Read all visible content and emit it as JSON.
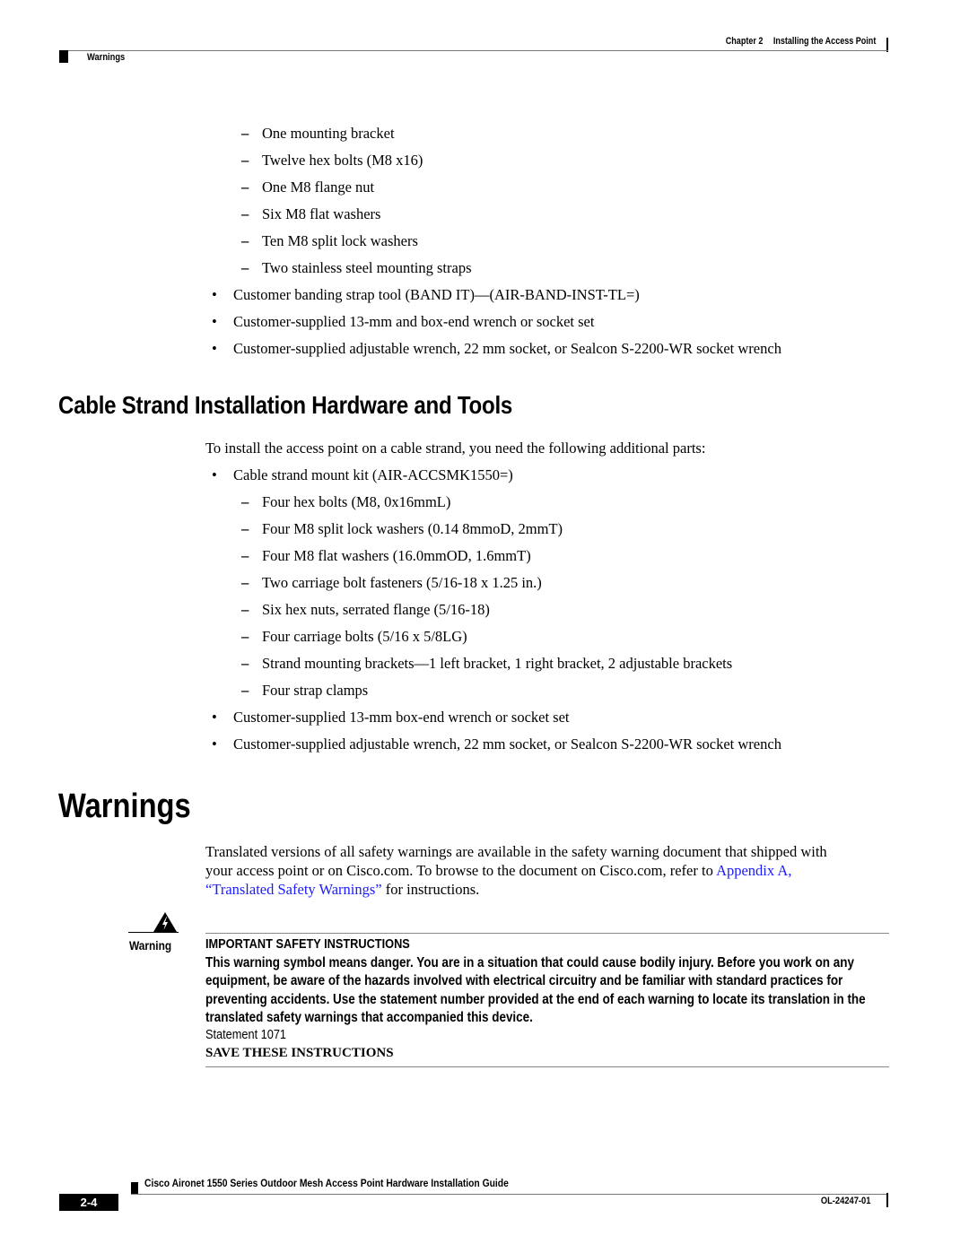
{
  "header": {
    "chapter_label": "Chapter 2",
    "chapter_title": "Installing the Access Point",
    "section": "Warnings"
  },
  "intro_list": {
    "dash_items": [
      "One mounting bracket",
      "Twelve hex bolts (M8 x16)",
      "One M8 flange nut",
      "Six M8 flat washers",
      "Ten M8 split lock washers",
      "Two stainless steel mounting straps"
    ],
    "bullet_items": [
      "Customer banding strap tool (BAND IT)—(AIR-BAND-INST-TL=)",
      "Customer-supplied 13-mm and box-end wrench or socket set",
      "Customer-supplied adjustable wrench, 22 mm socket, or Sealcon S-2200-WR socket wrench"
    ]
  },
  "cable_strand": {
    "heading": "Cable Strand Installation Hardware and Tools",
    "intro": "To install the access point on a cable strand, you need the following additional parts:",
    "kit_bullet": "Cable strand mount kit (AIR-ACCSMK1550=)",
    "dash_items": [
      "Four hex bolts (M8, 0x16mmL)",
      "Four M8 split lock washers (0.14 8mmoD, 2mmT)",
      "Four M8 flat washers (16.0mmOD, 1.6mmT)",
      "Two carriage bolt fasteners (5/16-18 x 1.25 in.)",
      "Six hex nuts, serrated flange (5/16-18)",
      "Four carriage bolts (5/16 x 5/8LG)",
      "Strand mounting brackets—1 left bracket, 1 right bracket, 2 adjustable brackets",
      "Four strap clamps"
    ],
    "bullet_items": [
      "Customer-supplied 13-mm box-end wrench or socket set",
      "Customer-supplied adjustable wrench, 22 mm socket, or Sealcon S-2200-WR socket wrench"
    ]
  },
  "warnings": {
    "heading": "Warnings",
    "para_line1": "Translated versions of all safety warnings are available in the safety warning document that shipped with",
    "para_line2_pre": "your access point or on Cisco.com. To browse to the document on Cisco.com, refer to ",
    "link_part1": "Appendix A,",
    "link_part2": "“Translated Safety Warnings”",
    "para_line3_post": " for instructions.",
    "warning_box": {
      "icon": "warning-triangle-lightning-icon",
      "label": "Warning",
      "title": "IMPORTANT SAFETY INSTRUCTIONS",
      "body": "This warning symbol means danger. You are in a situation that could cause bodily injury. Before you work on any equipment, be aware of the hazards involved with electrical circuitry and be familiar with standard practices for preventing accidents. Use the statement number provided at the end of each warning to locate its translation in the translated safety warnings that accompanied this device.",
      "statement": "Statement 1071",
      "save": "SAVE THESE INSTRUCTIONS"
    }
  },
  "footer": {
    "guide_title": "Cisco Aironet 1550 Series Outdoor Mesh Access Point Hardware Installation Guide",
    "page_number": "2-4",
    "doc_number": "OL-24247-01"
  }
}
